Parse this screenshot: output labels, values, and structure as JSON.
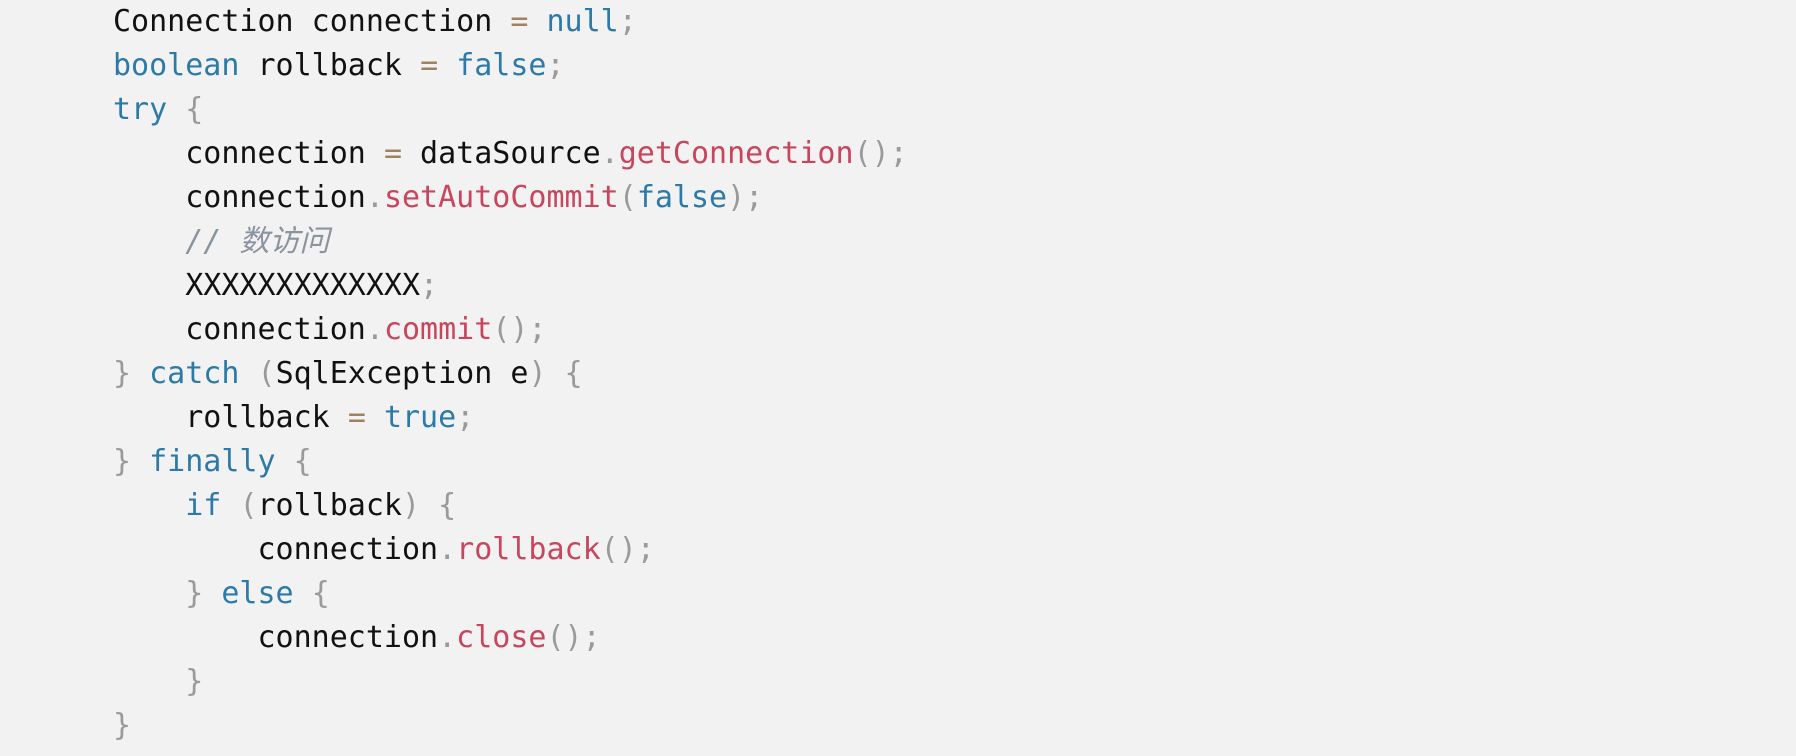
{
  "document": {
    "kind": "code-snippet",
    "language": "Java",
    "background_color": "#f2f2f2",
    "colors": {
      "plain": "#111111",
      "keyword": "#2d7aa8",
      "method": "#c8455e",
      "punctuation": "#9a9a9a",
      "operator": "#a08260",
      "comment": "#8a949e"
    },
    "lines": [
      {
        "id": "line-1",
        "text": "Connection connection = null;",
        "tokens": [
          {
            "t": "Connection",
            "c": "type"
          },
          {
            "t": " connection ",
            "c": "plain"
          },
          {
            "t": "=",
            "c": "op"
          },
          {
            "t": " ",
            "c": "plain"
          },
          {
            "t": "null",
            "c": "keyword"
          },
          {
            "t": ";",
            "c": "punct"
          }
        ]
      },
      {
        "id": "line-2",
        "text": "boolean rollback = false;",
        "tokens": [
          {
            "t": "boolean",
            "c": "keyword"
          },
          {
            "t": " rollback ",
            "c": "plain"
          },
          {
            "t": "=",
            "c": "op"
          },
          {
            "t": " ",
            "c": "plain"
          },
          {
            "t": "false",
            "c": "keyword"
          },
          {
            "t": ";",
            "c": "punct"
          }
        ]
      },
      {
        "id": "line-3",
        "text": "try {",
        "tokens": [
          {
            "t": "try",
            "c": "keyword"
          },
          {
            "t": " ",
            "c": "plain"
          },
          {
            "t": "{",
            "c": "punct"
          }
        ]
      },
      {
        "id": "line-4",
        "text": "    connection = dataSource.getConnection();",
        "tokens": [
          {
            "t": "    connection ",
            "c": "plain"
          },
          {
            "t": "=",
            "c": "op"
          },
          {
            "t": " dataSource",
            "c": "plain"
          },
          {
            "t": ".",
            "c": "punct"
          },
          {
            "t": "getConnection",
            "c": "method"
          },
          {
            "t": "();",
            "c": "punct"
          }
        ]
      },
      {
        "id": "line-5",
        "text": "    connection.setAutoCommit(false);",
        "tokens": [
          {
            "t": "    connection",
            "c": "plain"
          },
          {
            "t": ".",
            "c": "punct"
          },
          {
            "t": "setAutoCommit",
            "c": "method"
          },
          {
            "t": "(",
            "c": "punct"
          },
          {
            "t": "false",
            "c": "keyword"
          },
          {
            "t": ");",
            "c": "punct"
          }
        ]
      },
      {
        "id": "line-6",
        "text": "    // 数访问",
        "tokens": [
          {
            "t": "    ",
            "c": "plain"
          },
          {
            "t": "// 数访问",
            "c": "comment"
          }
        ]
      },
      {
        "id": "line-7",
        "text": "    XXXXXXXXXXXXX;",
        "tokens": [
          {
            "t": "    XXXXXXXXXXXXX",
            "c": "plain"
          },
          {
            "t": ";",
            "c": "punct"
          }
        ]
      },
      {
        "id": "line-8",
        "text": "    connection.commit();",
        "tokens": [
          {
            "t": "    connection",
            "c": "plain"
          },
          {
            "t": ".",
            "c": "punct"
          },
          {
            "t": "commit",
            "c": "method"
          },
          {
            "t": "();",
            "c": "punct"
          }
        ]
      },
      {
        "id": "line-9",
        "text": "} catch (SqlException e) {",
        "tokens": [
          {
            "t": "}",
            "c": "punct"
          },
          {
            "t": " ",
            "c": "plain"
          },
          {
            "t": "catch",
            "c": "keyword"
          },
          {
            "t": " ",
            "c": "plain"
          },
          {
            "t": "(",
            "c": "punct"
          },
          {
            "t": "SqlException e",
            "c": "plain"
          },
          {
            "t": ") {",
            "c": "punct"
          }
        ]
      },
      {
        "id": "line-10",
        "text": "    rollback = true;",
        "tokens": [
          {
            "t": "    rollback ",
            "c": "plain"
          },
          {
            "t": "=",
            "c": "op"
          },
          {
            "t": " ",
            "c": "plain"
          },
          {
            "t": "true",
            "c": "keyword"
          },
          {
            "t": ";",
            "c": "punct"
          }
        ]
      },
      {
        "id": "line-11",
        "text": "} finally {",
        "tokens": [
          {
            "t": "}",
            "c": "punct"
          },
          {
            "t": " ",
            "c": "plain"
          },
          {
            "t": "finally",
            "c": "keyword"
          },
          {
            "t": " ",
            "c": "plain"
          },
          {
            "t": "{",
            "c": "punct"
          }
        ]
      },
      {
        "id": "line-12",
        "text": "    if (rollback) {",
        "tokens": [
          {
            "t": "    ",
            "c": "plain"
          },
          {
            "t": "if",
            "c": "keyword"
          },
          {
            "t": " ",
            "c": "plain"
          },
          {
            "t": "(",
            "c": "punct"
          },
          {
            "t": "rollback",
            "c": "plain"
          },
          {
            "t": ") {",
            "c": "punct"
          }
        ]
      },
      {
        "id": "line-13",
        "text": "        connection.rollback();",
        "tokens": [
          {
            "t": "        connection",
            "c": "plain"
          },
          {
            "t": ".",
            "c": "punct"
          },
          {
            "t": "rollback",
            "c": "method"
          },
          {
            "t": "();",
            "c": "punct"
          }
        ]
      },
      {
        "id": "line-14",
        "text": "    } else {",
        "tokens": [
          {
            "t": "    ",
            "c": "plain"
          },
          {
            "t": "}",
            "c": "punct"
          },
          {
            "t": " ",
            "c": "plain"
          },
          {
            "t": "else",
            "c": "keyword"
          },
          {
            "t": " ",
            "c": "plain"
          },
          {
            "t": "{",
            "c": "punct"
          }
        ]
      },
      {
        "id": "line-15",
        "text": "        connection.close();",
        "tokens": [
          {
            "t": "        connection",
            "c": "plain"
          },
          {
            "t": ".",
            "c": "punct"
          },
          {
            "t": "close",
            "c": "method"
          },
          {
            "t": "();",
            "c": "punct"
          }
        ]
      },
      {
        "id": "line-16",
        "text": "    }",
        "tokens": [
          {
            "t": "    ",
            "c": "plain"
          },
          {
            "t": "}",
            "c": "punct"
          }
        ]
      },
      {
        "id": "line-17",
        "text": "}",
        "tokens": [
          {
            "t": "}",
            "c": "punct"
          }
        ]
      }
    ]
  }
}
